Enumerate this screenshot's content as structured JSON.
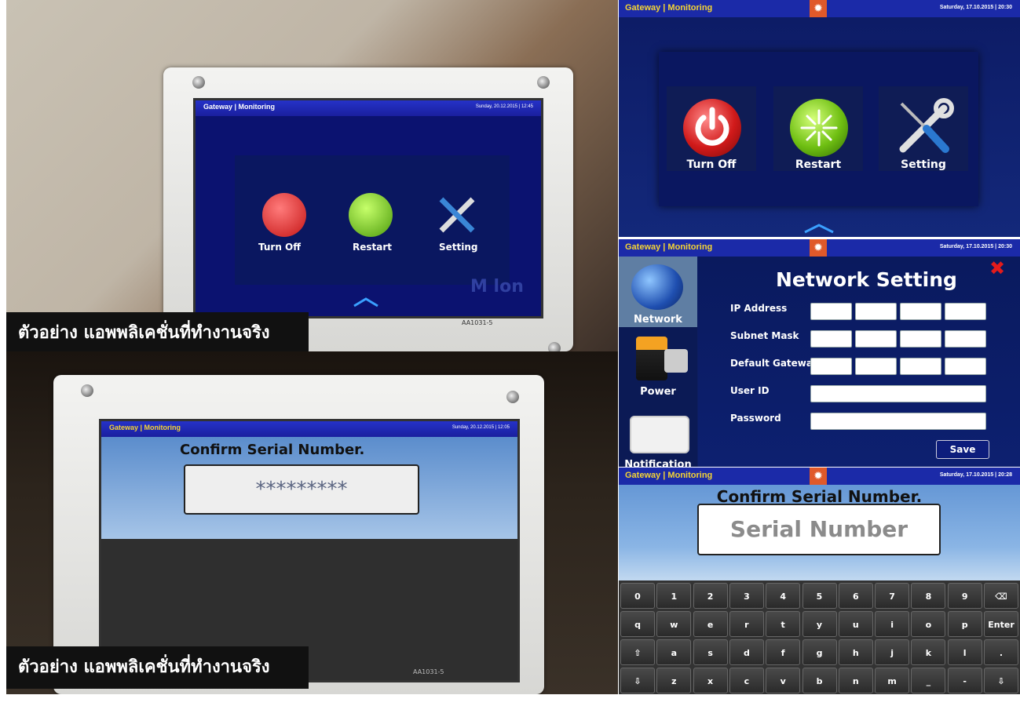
{
  "caption_text": "ตัวอย่าง แอพพลิเคชั่นที่ทำงานจริง",
  "photo_device_1": {
    "title": "Gateway | Monitoring",
    "date": "Sunday, 20.12.2015 | 12:45",
    "labels": [
      "Turn Off",
      "Restart",
      "Setting"
    ],
    "watermark": "M  lon",
    "model": "AA1031-5"
  },
  "photo_device_2": {
    "title": "Gateway | Monitoring",
    "date": "Sunday, 20.12.2015 | 12:05",
    "heading": "Confirm Serial Number.",
    "masked_value": "*********",
    "model": "AA1031-5"
  },
  "panel_a": {
    "title": "Gateway | Monitoring",
    "date": "Saturday, 17.10.2015 | 20:30",
    "buttons": {
      "turn_off": "Turn Off",
      "restart": "Restart",
      "setting": "Setting"
    }
  },
  "panel_b": {
    "title": "Gateway | Monitoring",
    "date": "Saturday, 17.10.2015 | 20:30",
    "heading": "Network Setting",
    "sidebar": [
      "Network",
      "Power",
      "Notification"
    ],
    "fields": {
      "ip": "IP Address",
      "subnet": "Subnet Mask",
      "gateway": "Default Gateway",
      "user": "User ID",
      "password": "Password"
    },
    "save": "Save",
    "accent": "#0d1d7c"
  },
  "panel_c": {
    "title": "Gateway | Monitoring",
    "date": "Saturday, 17.10.2015 | 20:28",
    "heading": "Confirm Serial Number.",
    "placeholder": "Serial Number",
    "keyboard": {
      "row1": [
        "0",
        "1",
        "2",
        "3",
        "4",
        "5",
        "6",
        "7",
        "8",
        "9",
        "⌫"
      ],
      "row2": [
        "q",
        "w",
        "e",
        "r",
        "t",
        "y",
        "u",
        "i",
        "o",
        "p",
        "Enter"
      ],
      "row3": [
        "⇧",
        "a",
        "s",
        "d",
        "f",
        "g",
        "h",
        "j",
        "k",
        "l",
        "."
      ],
      "row4": [
        "⇩",
        "z",
        "x",
        "c",
        "v",
        "b",
        "n",
        "m",
        "_",
        "-",
        "⇩"
      ]
    }
  }
}
